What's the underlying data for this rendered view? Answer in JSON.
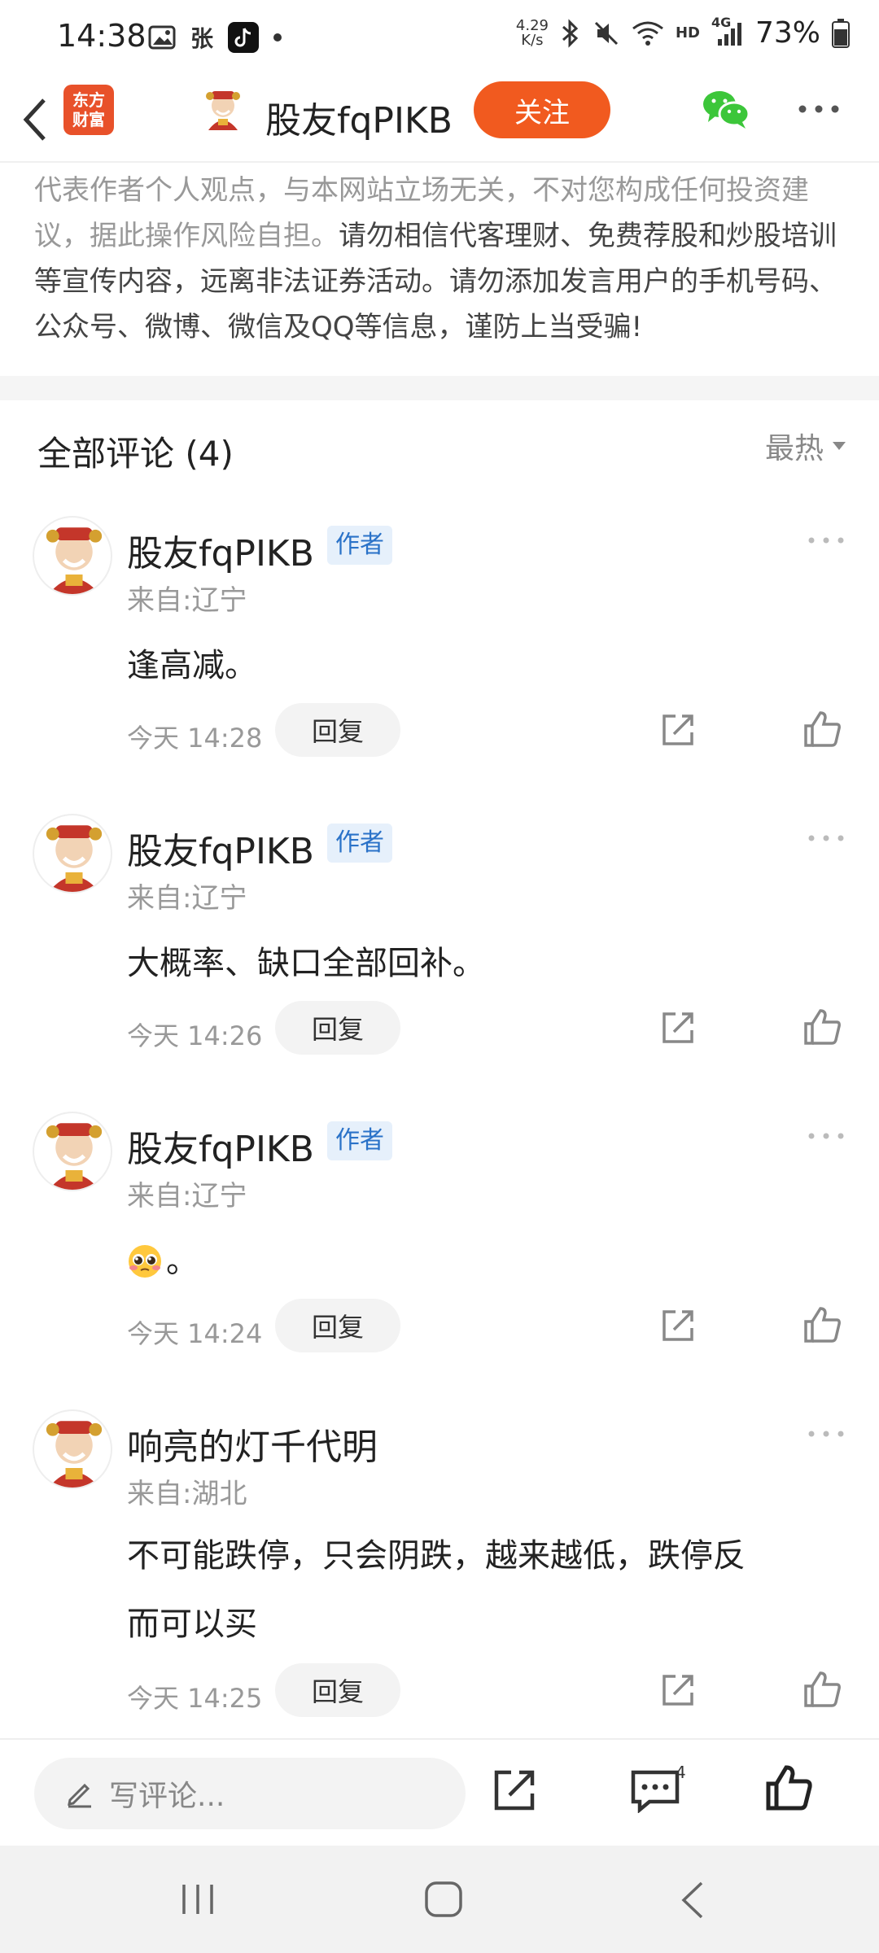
{
  "status_bar": {
    "time": "14:38",
    "left_icons": [
      "gallery-icon",
      "zhang-app-icon",
      "tiktok-icon",
      "dot-icon"
    ],
    "speed_value": "4.29",
    "speed_unit": "K/s",
    "hd_label": "HD",
    "net_label": "4G",
    "battery": "73%"
  },
  "top_bar": {
    "logo_line1": "东方",
    "logo_line2": "财富",
    "username": "股友fqPIKB",
    "follow_label": "关注",
    "brand_color": "#f15a1f"
  },
  "disclaimer": {
    "part1": "代表作者个人观点，与本网站立场无关，不对您构成任何投资建议，据此操作风险自担。",
    "part2": "请勿相信代客理财、免费荐股和炒股培训等宣传内容，远离非法证券活动。请勿添加发言用户的手机号码、公众号、微博、微信及QQ等信息，谨防上当受骗!"
  },
  "comments_header": {
    "title": "全部评论 (4)",
    "sort_label": "最热"
  },
  "comments": [
    {
      "name": "股友fqPIKB",
      "badge": "作者",
      "region": "来自:辽宁",
      "text": "逢高减。",
      "time": "今天 14:28",
      "reply_label": "回复"
    },
    {
      "name": "股友fqPIKB",
      "badge": "作者",
      "region": "来自:辽宁",
      "text": "大概率、缺口全部回补。",
      "time": "今天 14:26",
      "reply_label": "回复"
    },
    {
      "name": "股友fqPIKB",
      "badge": "作者",
      "region": "来自:辽宁",
      "text": "。",
      "emoji": "pleading-face-emoji",
      "time": "今天 14:24",
      "reply_label": "回复"
    },
    {
      "name": "响亮的灯千代明",
      "badge": "",
      "region": "来自:湖北",
      "text_line1": "不可能跌停，只会阴跌，越来越低，跌停反",
      "text_line2": "而可以买",
      "time": "今天 14:25",
      "reply_label": "回复"
    }
  ],
  "bottom_bar": {
    "write_placeholder": "写评论...",
    "comment_count": "4"
  }
}
